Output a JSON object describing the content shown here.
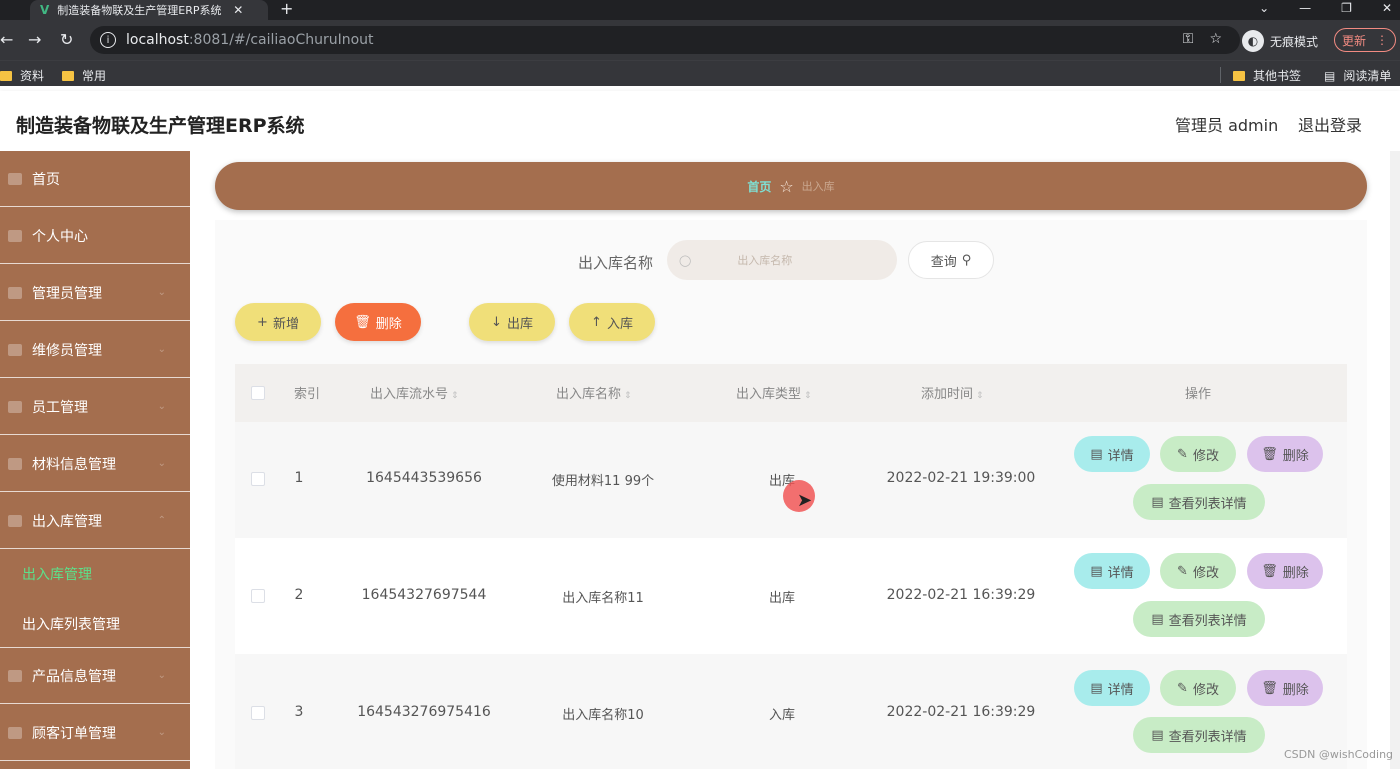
{
  "browser": {
    "tab_title": "制造装备物联及生产管理ERP系统",
    "url_host": "localhost",
    "url_rest": ":8081/#/cailiaoChuruInout",
    "incognito_label": "无痕模式",
    "update_label": "更新",
    "bookmarks": [
      "资料",
      "常用"
    ],
    "other_bookmarks": "其他书签",
    "reading_list": "阅读清单"
  },
  "header": {
    "title": "制造装备物联及生产管理ERP系统",
    "user_label": "管理员 admin",
    "logout": "退出登录"
  },
  "sidebar": {
    "items": [
      {
        "label": "首页"
      },
      {
        "label": "个人中心"
      },
      {
        "label": "管理员管理"
      },
      {
        "label": "维修员管理"
      },
      {
        "label": "员工管理"
      },
      {
        "label": "材料信息管理"
      },
      {
        "label": "出入库管理"
      },
      {
        "label": "产品信息管理"
      },
      {
        "label": "顾客订单管理"
      }
    ],
    "sub_items": [
      {
        "label": "出入库管理",
        "active": true
      },
      {
        "label": "出入库列表管理",
        "active": false
      }
    ],
    "active_color": "#5de08a"
  },
  "breadcrumb": {
    "home": "首页",
    "current": "出入库"
  },
  "search": {
    "label": "出入库名称",
    "placeholder": "出入库名称",
    "button": "查询"
  },
  "actions": {
    "add": "新增",
    "delete": "删除",
    "out": "出库",
    "in": "入库"
  },
  "table": {
    "headers": [
      "索引",
      "出入库流水号",
      "出入库名称",
      "出入库类型",
      "添加时间",
      "操作"
    ],
    "rows": [
      {
        "index": "1",
        "serial": "1645443539656",
        "name": "使用材料11 99个",
        "type": "出库",
        "time": "2022-02-21 19:39:00"
      },
      {
        "index": "2",
        "serial": "16454327697544",
        "name": "出入库名称11",
        "type": "出库",
        "time": "2022-02-21 16:39:29"
      },
      {
        "index": "3",
        "serial": "164543276975416",
        "name": "出入库名称10",
        "type": "入库",
        "time": "2022-02-21 16:39:29"
      }
    ],
    "row_actions": {
      "detail": "详情",
      "edit": "修改",
      "delete": "删除",
      "list_detail": "查看列表详情"
    }
  },
  "watermark": "CSDN @wishCoding"
}
